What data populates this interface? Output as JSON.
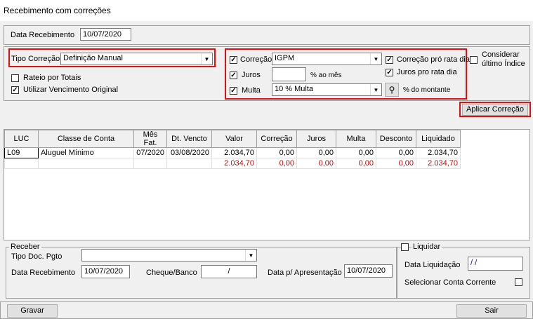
{
  "window": {
    "title": "Recebimento com correções"
  },
  "header": {
    "data_recebimento_label": "Data Recebimento",
    "data_recebimento_value": "10/07/2020"
  },
  "tipo": {
    "label": "Tipo Correção",
    "value": "Definição Manual",
    "rateio_label": "Rateio por Totais",
    "rateio_checked": false,
    "utilizar_label": "Utilizar Vencimento Original",
    "utilizar_checked": true
  },
  "correcao": {
    "correcao_label": "Correção",
    "correcao_value": "IGPM",
    "juros_label": "Juros",
    "juros_value": "",
    "juros_unit": "% ao mês",
    "multa_label": "Multa",
    "multa_value": "10 % Multa",
    "multa_unit": "% do montante",
    "pro_rata_label": "Correção pró rata dia",
    "juros_pro_rata_label": "Juros pro rata dia",
    "considerar_label_1": "Considerar",
    "considerar_label_2": "último Índice"
  },
  "buttons": {
    "aplicar": "Aplicar Correção",
    "gravar": "Gravar",
    "sair": "Sair"
  },
  "grid": {
    "columns": [
      "LUC",
      "Classe de Conta",
      "Mês Fat.",
      "Dt. Vencto",
      "Valor",
      "Correção",
      "Juros",
      "Multa",
      "Desconto",
      "Liquidado"
    ],
    "rows": [
      [
        "L09",
        "Aluguel Mínimo",
        "07/2020",
        "03/08/2020",
        "2.034,70",
        "0,00",
        "0,00",
        "0,00",
        "0,00",
        "2.034,70"
      ]
    ],
    "totals": [
      "",
      "",
      "",
      "",
      "2.034,70",
      "0,00",
      "0,00",
      "0,00",
      "0,00",
      "2.034,70"
    ]
  },
  "receber": {
    "legend": "Receber",
    "tipo_doc_label": "Tipo Doc. Pgto",
    "tipo_doc_value": "",
    "data_recebimento_label": "Data Recebimento",
    "data_recebimento_value": "10/07/2020",
    "cheque_label": "Cheque/Banco",
    "cheque_value": "/",
    "data_apresentacao_label": "Data p/ Apresentação",
    "data_apresentacao_value": "10/07/2020"
  },
  "liquidar": {
    "legend": "Liquidar",
    "data_liquidacao_label": "Data Liquidação",
    "data_liquidacao_value": "/ /",
    "selecionar_label": "Selecionar Conta Corrente"
  },
  "colors": {
    "highlight": "#e01010",
    "totals_text": "#d00000"
  }
}
